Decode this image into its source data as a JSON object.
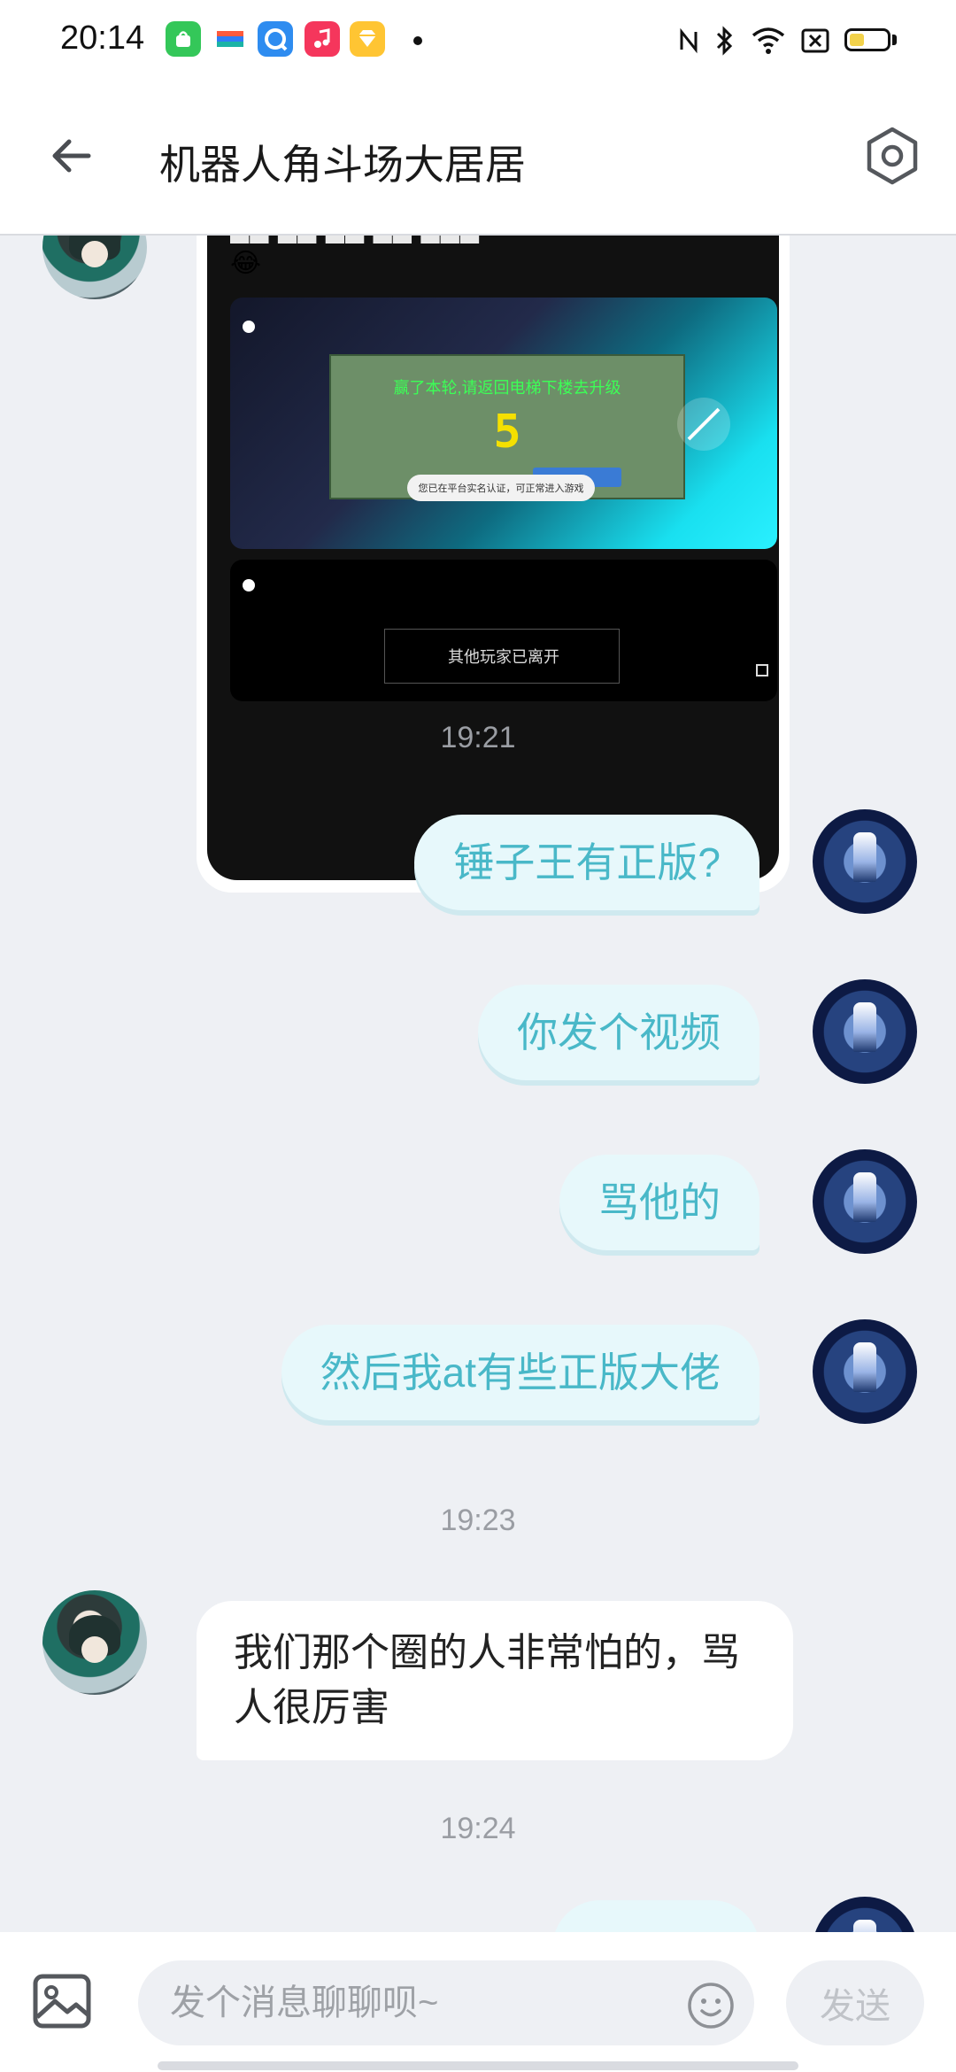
{
  "status_bar": {
    "time": "20:14",
    "app_icons": [
      "bag-app-icon",
      "wallet-app-icon",
      "browser-app-icon",
      "music-app-icon",
      "diamond-app-icon"
    ],
    "battery_level": 0.4
  },
  "header": {
    "title": "机器人角斗场大居居"
  },
  "messages": {
    "image_message": {
      "game_panel_text": "赢了本轮,请返回电梯下楼去升级",
      "game_panel_number": "5",
      "toast_text": "您已在平台实名认证，可正常进入游戏",
      "bottom_text": "其他玩家已离开"
    },
    "time_1": "19:21",
    "outgoing_1": "锤子王有正版?",
    "outgoing_2": "你发个视频",
    "outgoing_3": "骂他的",
    "outgoing_4": "然后我at有些正版大佬",
    "time_2": "19:23",
    "incoming_1": "我们那个圈的人非常怕的，骂人很厉害",
    "time_3": "19:24"
  },
  "input": {
    "placeholder": "发个消息聊聊呗~",
    "send_label": "发送"
  },
  "colors": {
    "outgoing_bubble": "#e7f8fb",
    "outgoing_text": "#49b8c8",
    "background": "#eef0f4"
  }
}
